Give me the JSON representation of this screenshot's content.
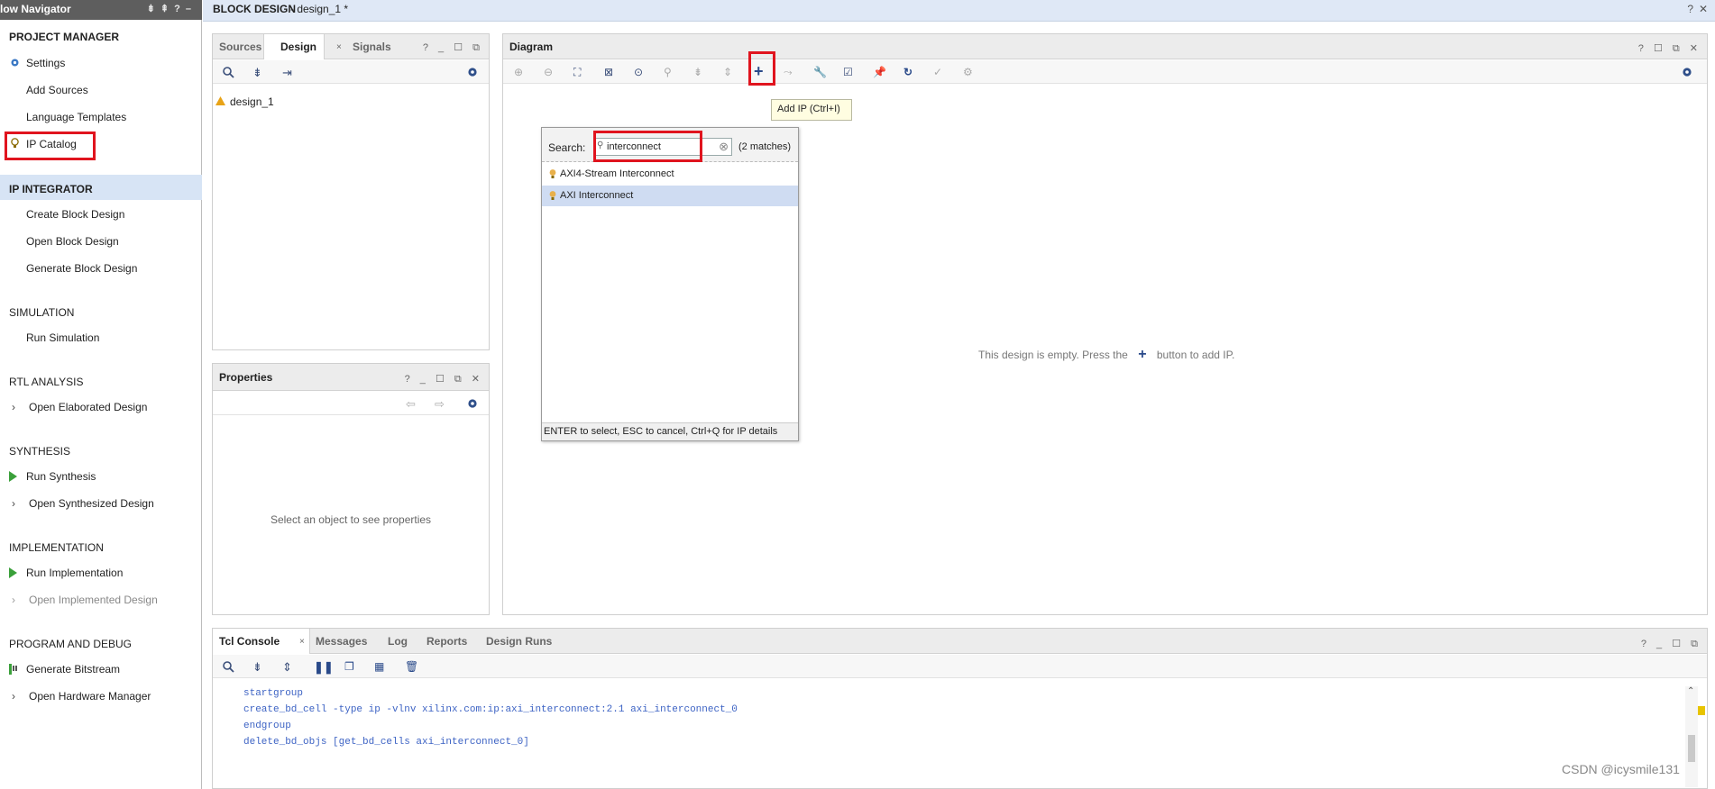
{
  "flow_nav": {
    "title": "low Navigator",
    "sections": {
      "project_manager": "PROJECT MANAGER",
      "ip_integrator": "IP INTEGRATOR",
      "simulation": "SIMULATION",
      "rtl_analysis": "RTL ANALYSIS",
      "synthesis": "SYNTHESIS",
      "implementation": "IMPLEMENTATION",
      "program_debug": "PROGRAM AND DEBUG"
    },
    "items": {
      "settings": "Settings",
      "add_sources": "Add Sources",
      "language_templates": "Language Templates",
      "ip_catalog": "IP Catalog",
      "create_bd": "Create Block Design",
      "open_bd": "Open Block Design",
      "generate_bd": "Generate Block Design",
      "run_sim": "Run Simulation",
      "open_elab": "Open Elaborated Design",
      "run_synth": "Run Synthesis",
      "open_synth": "Open Synthesized Design",
      "run_impl": "Run Implementation",
      "open_impl": "Open Implemented Design",
      "gen_bitstream": "Generate Bitstream",
      "open_hw": "Open Hardware Manager"
    }
  },
  "topbar": {
    "title": "BLOCK DESIGN",
    "subtitle": "- design_1 *",
    "help": "?",
    "close": "✕"
  },
  "sources_panel": {
    "tabs": [
      "Sources",
      "Design",
      "Signals"
    ],
    "active_tab": "Design",
    "tree_item": "design_1"
  },
  "properties_panel": {
    "title": "Properties",
    "empty": "Select an object to see properties"
  },
  "diagram": {
    "title": "Diagram",
    "tooltip": "Add IP (Ctrl+I)",
    "empty_msg_a": "This design is empty. Press the",
    "empty_msg_b": "button to add IP."
  },
  "ip_popup": {
    "search_label": "Search:",
    "search_value": "interconnect",
    "matches": "(2 matches)",
    "results": [
      "AXI4-Stream Interconnect",
      "AXI Interconnect"
    ],
    "selected_index": 1,
    "footer": "ENTER to select, ESC to cancel, Ctrl+Q for IP details"
  },
  "console": {
    "tabs": [
      "Tcl Console",
      "Messages",
      "Log",
      "Reports",
      "Design Runs"
    ],
    "active_tab": "Tcl Console",
    "lines": [
      "startgroup",
      "create_bd_cell -type ip -vlnv xilinx.com:ip:axi_interconnect:2.1 axi_interconnect_0",
      "endgroup",
      "delete_bd_objs [get_bd_cells axi_interconnect_0]"
    ]
  },
  "watermark": "CSDN @icysmile131",
  "colors": {
    "highlight_red": "#e0141e",
    "selection": "#cfdcf2",
    "header_blue": "#dfe8f6",
    "run_green": "#3aa03a"
  }
}
